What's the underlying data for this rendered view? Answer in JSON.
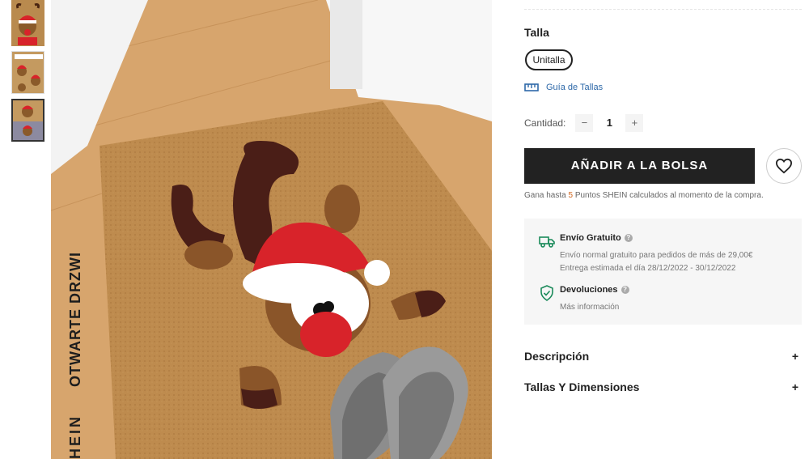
{
  "brand_vertical": "OTWARTE DRZWI",
  "brand_vertical_bottom": "HEIN",
  "product": {
    "size_label": "Talla",
    "size_option": "Unitalla",
    "size_guide": "Guía de Tallas",
    "quantity_label": "Cantidad:",
    "quantity_minus": "−",
    "quantity_value": "1",
    "quantity_plus": "+",
    "add_to_bag": "AÑADIR A LA BOLSA",
    "points_prefix": "Gana hasta ",
    "points_value": "5",
    "points_suffix": " Puntos SHEIN calculados al momento de la compra."
  },
  "shipping": {
    "free_title": "Envío Gratuito",
    "free_line1": "Envío normal gratuito para pedidos de más de 29,00€",
    "free_line2": "Entrega estimada el día 28/12/2022 - 30/12/2022",
    "returns_title": "Devoluciones",
    "returns_more": "Más información",
    "help_glyph": "?"
  },
  "accordions": [
    {
      "title": "Descripción",
      "icon": "+"
    },
    {
      "title": "Tallas Y Dimensiones",
      "icon": "+"
    }
  ],
  "icons": {
    "size_guide": "ruler-icon",
    "wishlist": "heart-icon",
    "free_shipping": "truck-icon",
    "returns": "shield-check-icon"
  },
  "colors": {
    "button_dark": "#222222",
    "link_blue": "#2d68a8",
    "points_orange": "#d0651e",
    "icon_green": "#1a8a5a"
  }
}
